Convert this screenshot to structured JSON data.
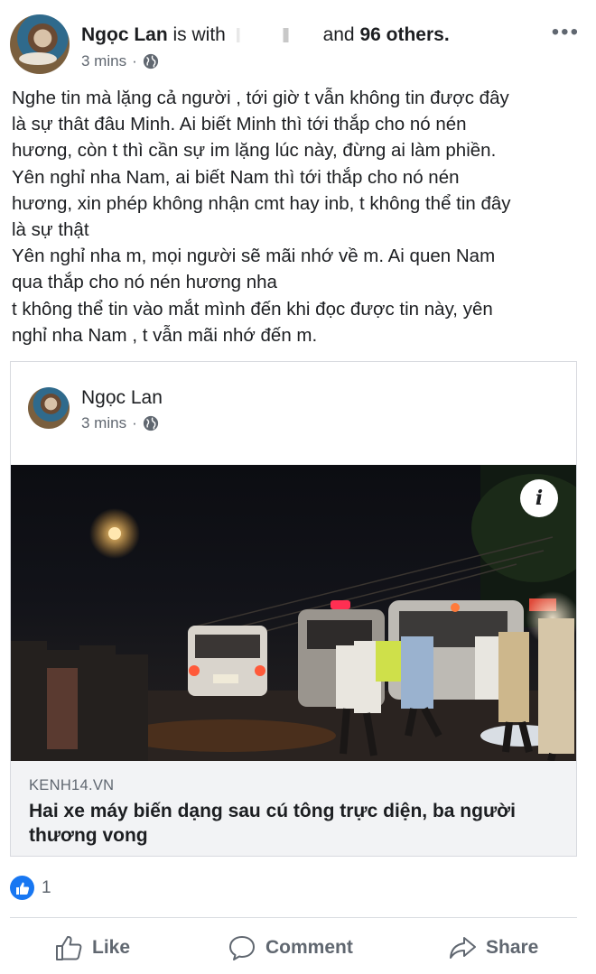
{
  "post": {
    "author": "Ngọc Lan",
    "with_text": "is with",
    "and_text": "and",
    "others": "96 others.",
    "time": "3 mins",
    "more_label": "•••",
    "lines": [
      "Nghe tin mà lặng cả người , tới giờ t vẫn không tin được đây",
      "là sự thât đâu Minh. Ai biết Minh thì tới thắp cho nó nén",
      "hương, còn t thì cần sự im lặng lúc này, đừng ai làm phiền.",
      "Yên nghỉ nha Nam, ai biết Nam  thì tới thắp cho nó nén",
      "hương, xin phép không nhận cmt hay inb, t không thể tin đây",
      "là sự thật",
      "Yên nghỉ nha m, mọi người sẽ mãi nhớ về m. Ai quen Nam",
      "qua thắp cho nó nén hương nha",
      "t không thể tin vào mắt mình đến khi đọc được tin này, yên",
      "nghỉ nha Nam , t vẫn mãi nhớ đến m."
    ]
  },
  "shared": {
    "author": "Ngọc Lan",
    "time": "3 mins",
    "info_label": "i",
    "domain": "KENH14.VN",
    "headline": "Hai xe máy biến dạng sau cú tông trực diện, ba người thương vong"
  },
  "reactions": {
    "count": "1"
  },
  "actions": {
    "like": "Like",
    "comment": "Comment",
    "share": "Share"
  },
  "colors": {
    "accent": "#1877f2",
    "text": "#1c1e21",
    "muted": "#606770"
  }
}
